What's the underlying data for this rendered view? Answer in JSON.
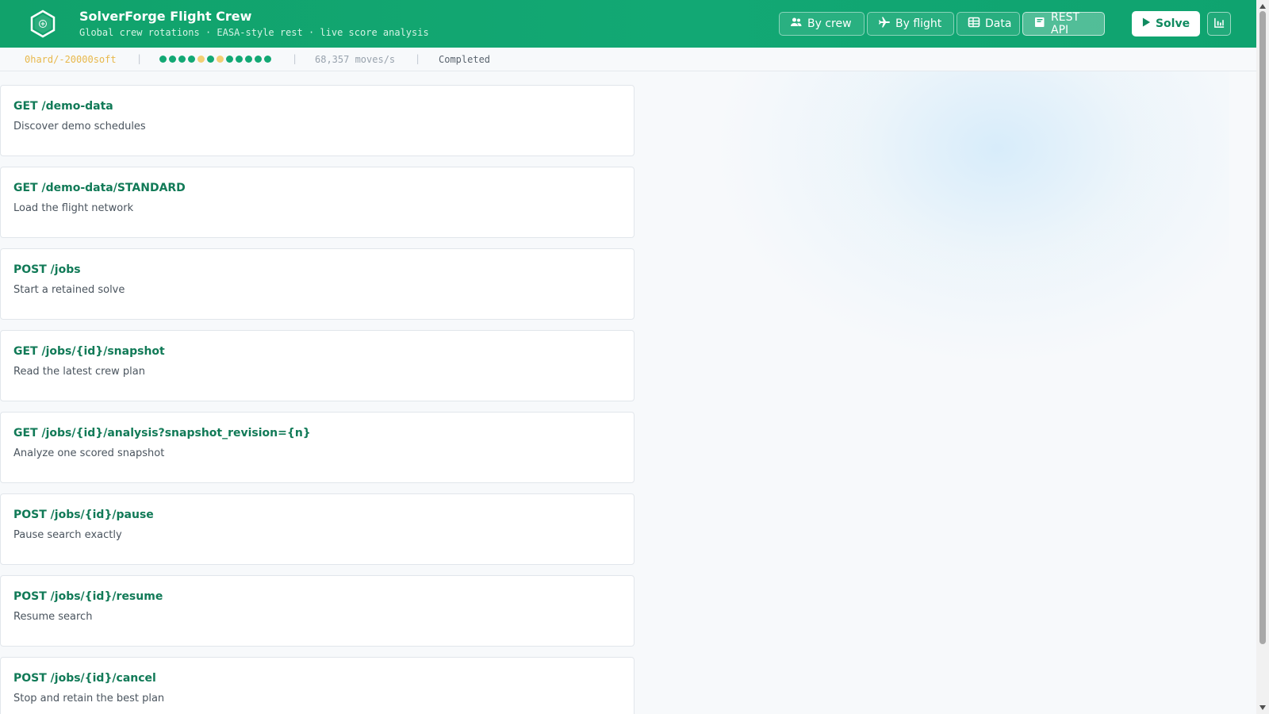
{
  "app": {
    "title": "SolverForge Flight Crew",
    "subtitle": "Global crew rotations · EASA-style rest · live score analysis"
  },
  "nav": {
    "buttons": [
      {
        "label": "By crew",
        "icon": "users-icon"
      },
      {
        "label": "By flight",
        "icon": "plane-icon"
      },
      {
        "label": "Data",
        "icon": "table-icon"
      },
      {
        "label": "REST API",
        "icon": "book-icon",
        "active": true
      }
    ],
    "solve_label": "Solve",
    "analysis_icon": "bar-chart-icon"
  },
  "status": {
    "score": "0hard/-20000soft",
    "moves": "68,357 moves/s",
    "state": "Completed",
    "dots": [
      "#12a874",
      "#12a874",
      "#12a874",
      "#12a874",
      "#f2cf74",
      "#12a874",
      "#f2cf74",
      "#12a874",
      "#12a874",
      "#12a874",
      "#12a874",
      "#12a874"
    ]
  },
  "endpoints": [
    {
      "endpoint": "GET /demo-data",
      "description": "Discover demo schedules"
    },
    {
      "endpoint": "GET /demo-data/STANDARD",
      "description": "Load the flight network"
    },
    {
      "endpoint": "POST /jobs",
      "description": "Start a retained solve"
    },
    {
      "endpoint": "GET /jobs/{id}/snapshot",
      "description": "Read the latest crew plan"
    },
    {
      "endpoint": "GET /jobs/{id}/analysis?snapshot_revision={n}",
      "description": "Analyze one scored snapshot"
    },
    {
      "endpoint": "POST /jobs/{id}/pause",
      "description": "Pause search exactly"
    },
    {
      "endpoint": "POST /jobs/{id}/resume",
      "description": "Resume search"
    },
    {
      "endpoint": "POST /jobs/{id}/cancel",
      "description": "Stop and retain the best plan"
    }
  ],
  "colors": {
    "brand": "#12a874",
    "endpoint_text": "#117a57",
    "score": "#e8b84b"
  }
}
